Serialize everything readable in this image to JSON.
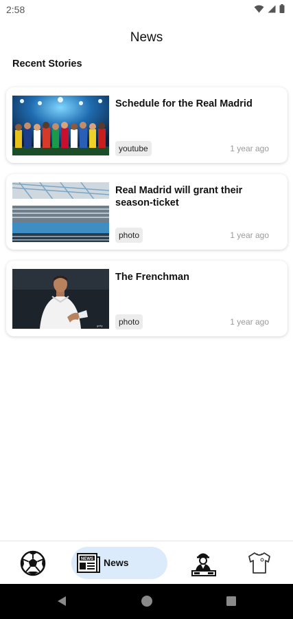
{
  "status_bar": {
    "time": "2:58"
  },
  "header": {
    "title": "News"
  },
  "section": {
    "title": "Recent Stories"
  },
  "stories": [
    {
      "title": "Schedule for the Real Madrid",
      "tag": "youtube",
      "time": "1 year ago",
      "thumbnail": "players-lineup-image"
    },
    {
      "title": "Real Madrid will grant their season-ticket",
      "tag": "photo",
      "time": "1 year ago",
      "thumbnail": "stadium-image"
    },
    {
      "title": "The Frenchman",
      "tag": "photo",
      "time": "1 year ago",
      "thumbnail": "player-celebration-image"
    }
  ],
  "bottom_nav": {
    "items": [
      {
        "icon": "soccer-ball-icon",
        "label": ""
      },
      {
        "icon": "newspaper-icon",
        "label": "News",
        "active": true
      },
      {
        "icon": "coach-icon",
        "label": ""
      },
      {
        "icon": "jersey-icon",
        "label": ""
      }
    ]
  },
  "colors": {
    "active_nav_bg": "#dcebfb",
    "tag_bg": "#ececec",
    "time_text": "#9a9a9a"
  }
}
